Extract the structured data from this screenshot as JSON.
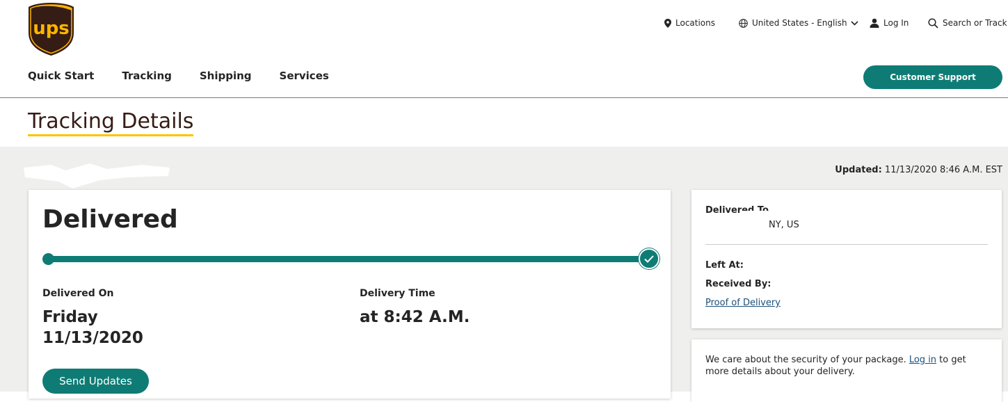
{
  "brand": {
    "logo_text": "ups",
    "brand_color": "#351c15",
    "accent_color": "#ffc400",
    "teal": "#0e7c75"
  },
  "utility_nav": {
    "locations": "Locations",
    "language": "United States - English",
    "login": "Log In",
    "search": "Search or Track"
  },
  "main_nav": {
    "items": [
      "Quick Start",
      "Tracking",
      "Shipping",
      "Services"
    ],
    "support_button": "Customer Support"
  },
  "page": {
    "title": "Tracking Details"
  },
  "updated": {
    "label": "Updated:",
    "value": "11/13/2020 8:46 A.M. EST"
  },
  "status": {
    "title": "Delivered",
    "progress": 1.0,
    "delivered_on_label": "Delivered On",
    "delivered_day": "Friday",
    "delivered_date": "11/13/2020",
    "delivery_time_label": "Delivery Time",
    "delivery_time": "at 8:42 A.M.",
    "send_updates": "Send Updates"
  },
  "delivery_info": {
    "delivered_to_label": "Delivered To",
    "address": "NY, US",
    "left_at_label": "Left At:",
    "received_by_label": "Received By:",
    "proof_link": "Proof of Delivery"
  },
  "security": {
    "text_before": "We care about the security of your package. ",
    "login_link": "Log in",
    "text_after": " to get more details about your delivery."
  }
}
